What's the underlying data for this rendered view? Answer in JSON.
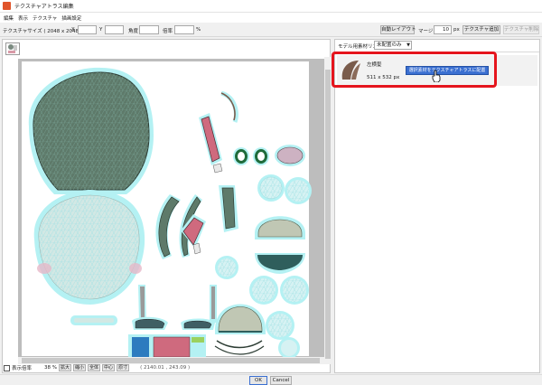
{
  "window": {
    "title": "テクスチャアトラス編集"
  },
  "menu": {
    "items": [
      "編集",
      "表示",
      "テクスチャ",
      "描画設定"
    ]
  },
  "toolbar": {
    "texture_size_label": "テクスチャサイズ ( 2048 x 2048 )",
    "x_label": "X",
    "x_value": "",
    "y_label": "Y",
    "y_value": "",
    "angle_label": "角度",
    "angle_value": "",
    "scale_label": "倍率",
    "scale_value": "",
    "percent_unit": "%",
    "auto_layout_label": "自動レイアウト",
    "margin_label": "マージン",
    "margin_value": "10",
    "margin_unit": "px",
    "add_texture_label": "テクスチャ追加",
    "remove_texture_label": "テクスチャ削除"
  },
  "status": {
    "show_ratio_label": "表示倍率",
    "zoom_value": "38 %",
    "zoom_in_label": "拡大",
    "zoom_out_label": "縮小",
    "fit_all_label": "全体",
    "center_label": "中心",
    "actual_size_label": "原寸",
    "coords_text": "( 2140.01 , 243.09 )"
  },
  "right_panel": {
    "model_list_label": "モデル用素材リスト",
    "filter_value": "未配置のみ",
    "items": [
      {
        "name": "左横髪",
        "size": "511 x 532 px",
        "action_label": "選択素材をテクスチャアトラスに配置"
      }
    ]
  },
  "dialog": {
    "ok_label": "OK",
    "cancel_label": "Cancel"
  },
  "colors": {
    "hair": "#5e7a6a",
    "face": "#cfe6e2",
    "sleeve": "#cf6a7e",
    "outline_glow": "#b4f1f3",
    "highlight_red": "#e5151d",
    "button_blue": "#3a6fd1"
  }
}
